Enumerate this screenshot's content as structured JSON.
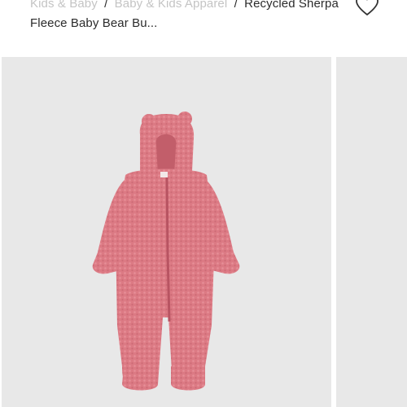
{
  "breadcrumb": {
    "items": [
      "Kids & Baby",
      "Baby & Kids Apparel"
    ],
    "separator": "/",
    "current": "Recycled Sherpa Fleece Baby Bear Bu..."
  },
  "product_image": {
    "subject": "pink sherpa fleece baby bear bunting",
    "color": "#dd7b84"
  },
  "icons": {
    "favorite": "heart-outline-icon"
  }
}
